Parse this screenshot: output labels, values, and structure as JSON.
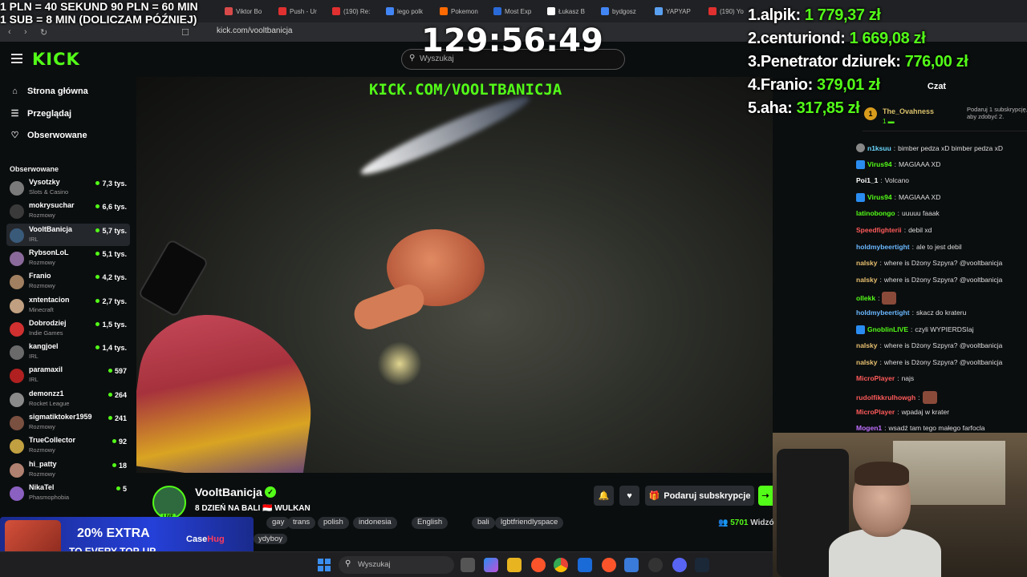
{
  "browser": {
    "tabs": [
      {
        "label": "Viktor Bo",
        "color": "#d84a4a"
      },
      {
        "label": "Push - Ur",
        "color": "#e03030"
      },
      {
        "label": "(190) Re:",
        "color": "#e03030"
      },
      {
        "label": "lego polk",
        "color": "#4285f4"
      },
      {
        "label": "Pokemon",
        "color": "#ff6a00"
      },
      {
        "label": "Most Exp",
        "color": "#2a6ad8"
      },
      {
        "label": "Łukasz B",
        "color": "#ffffff"
      },
      {
        "label": "bydgosz",
        "color": "#4285f4"
      },
      {
        "label": "YAPYAP",
        "color": "#5aa0f0"
      },
      {
        "label": "(190) Yo",
        "color": "#e03030"
      }
    ],
    "url": "kick.com/vooltbanicja"
  },
  "header": {
    "logo": "KICK",
    "search_placeholder": "Wyszukaj"
  },
  "sidebar": {
    "nav": [
      {
        "label": "Strona główna",
        "icon": "home-icon"
      },
      {
        "label": "Przeglądaj",
        "icon": "browse-icon"
      },
      {
        "label": "Obserwowane",
        "icon": "heart-icon"
      }
    ],
    "section_title": "Obserwowane",
    "channels": [
      {
        "name": "Vysotzky",
        "category": "Slots & Casino",
        "viewers": "7,3 tys.",
        "color": "#7a7a7a"
      },
      {
        "name": "mokrysuchar",
        "category": "Rozmowy",
        "viewers": "6,6 tys.",
        "color": "#3a3a3a"
      },
      {
        "name": "VooltBanicja",
        "category": "IRL",
        "viewers": "5,7 tys.",
        "color": "#3a5a7a"
      },
      {
        "name": "RybsonLoL",
        "category": "Rozmowy",
        "viewers": "5,1 tys.",
        "color": "#8a6a9a"
      },
      {
        "name": "Franio",
        "category": "Rozmowy",
        "viewers": "4,2 tys.",
        "color": "#a08060"
      },
      {
        "name": "xntentacion",
        "category": "Minecraft",
        "viewers": "2,7 tys.",
        "color": "#c0a080"
      },
      {
        "name": "Dobrodziej",
        "category": "Indie Games",
        "viewers": "1,5 tys.",
        "color": "#d03030"
      },
      {
        "name": "kangjoel",
        "category": "IRL",
        "viewers": "1,4 tys.",
        "color": "#6a6a6a"
      },
      {
        "name": "paramaxil",
        "category": "IRL",
        "viewers": "597",
        "color": "#b02020"
      },
      {
        "name": "demonzz1",
        "category": "Rocket League",
        "viewers": "264",
        "color": "#8a8a8a"
      },
      {
        "name": "sigmatiktoker1959",
        "category": "Rozmowy",
        "viewers": "241",
        "color": "#7a5040"
      },
      {
        "name": "TrueCollector",
        "category": "Rozmowy",
        "viewers": "92",
        "color": "#c0a040"
      },
      {
        "name": "hi_patty",
        "category": "Rozmowy",
        "viewers": "18",
        "color": "#b08070"
      },
      {
        "name": "NikaTel",
        "category": "Phasmophobia",
        "viewers": "5",
        "color": "#8a60c0"
      }
    ]
  },
  "overlay": {
    "donation_line1": "1 PLN = 40 SEKUND 90 PLN = 60 MIN",
    "donation_line2": "1 SUB = 8 MIN (DOLICZAM PÓŹNIEJ)",
    "timer": "129:56:49",
    "watermark": "KICK.COM/VOOLTBANICJA",
    "leaderboard": [
      {
        "label": "1.alpik:",
        "amount": "1 779,37 zł"
      },
      {
        "label": "2.centuriond:",
        "amount": "1 669,08 zł"
      },
      {
        "label": "3.Penetrator dziurek:",
        "amount": "776,00 zł"
      },
      {
        "label": "4.Franio:",
        "amount": "379,01 zł"
      },
      {
        "label": "5.aha:",
        "amount": "317,85 zł"
      }
    ]
  },
  "stream": {
    "channel_name": "VooltBanicja",
    "title": "8 DZIEŃ NA BALI 🇮🇩 WULKAN",
    "live_label": "LIVE",
    "tags": [
      "gay",
      "trans",
      "polish",
      "indonesia",
      "English",
      "bali",
      "lgbtfriendlyspace"
    ],
    "partial_tag": "ydyboy",
    "subscribe_label": "Podaruj subskrypcje",
    "viewer_count": "5701",
    "viewer_suffix": "Widzó"
  },
  "promo": {
    "line1": "20% EXTRA",
    "line2": "TO EVERY TOP-UP",
    "brand_a": "Case",
    "brand_b": "Hug"
  },
  "chat": {
    "header": "Czat",
    "pinned_user": "The_Ovahness",
    "pinned_count": "1",
    "pinned_text": "Podaruj 1 subskrypcję, aby zdobyć 2.",
    "messages": [
      {
        "user": "n1ksuu",
        "text": "bimber pedza xD bimber pedza xD",
        "color": "#6ad8ff"
      },
      {
        "user": "Virus94",
        "text": "MAGIAAA XD",
        "color": "#53fc18"
      },
      {
        "user": "Poi1_1",
        "text": "Volcano",
        "color": "#ffffff"
      },
      {
        "user": "Virus94",
        "text": "MAGIAAA XD",
        "color": "#53fc18"
      },
      {
        "user": "latinobongo",
        "text": "uuuuu faaak",
        "color": "#53fc18"
      },
      {
        "user": "Speedfighterii",
        "text": "debil xd",
        "color": "#ff5a5a"
      },
      {
        "user": "holdmybeertight",
        "text": "ale to jest debil",
        "color": "#6ab8ff"
      },
      {
        "user": "nalsky",
        "text": "where is Dżony Szpyra? @vooltbanicja",
        "color": "#e8c070"
      },
      {
        "user": "nalsky",
        "text": "where is Dżony Szpyra? @vooltbanicja",
        "color": "#e8c070"
      },
      {
        "user": "ollekk",
        "text": "",
        "color": "#53fc18"
      },
      {
        "user": "holdmybeertight",
        "text": "skacz do krateru",
        "color": "#6ab8ff"
      },
      {
        "user": "GnoblinLIVE",
        "text": "czyli WYPIERDSIaj",
        "color": "#53fc18"
      },
      {
        "user": "nalsky",
        "text": "where is Dżony Szpyra? @vooltbanicja",
        "color": "#e8c070"
      },
      {
        "user": "nalsky",
        "text": "where is Dżony Szpyra? @vooltbanicja",
        "color": "#e8c070"
      },
      {
        "user": "MicroPlayer",
        "text": "najs",
        "color": "#ff5a5a"
      },
      {
        "user": "rudolfikkrulhowgh",
        "text": "",
        "color": "#ff5a5a"
      },
      {
        "user": "MicroPlayer",
        "text": "wpadaj w krater",
        "color": "#ff5a5a"
      },
      {
        "user": "Mogen1",
        "text": "wsadź tam tego małego farfocla",
        "color": "#c070ff"
      }
    ]
  },
  "taskbar": {
    "search_placeholder": "Wyszukaj"
  }
}
